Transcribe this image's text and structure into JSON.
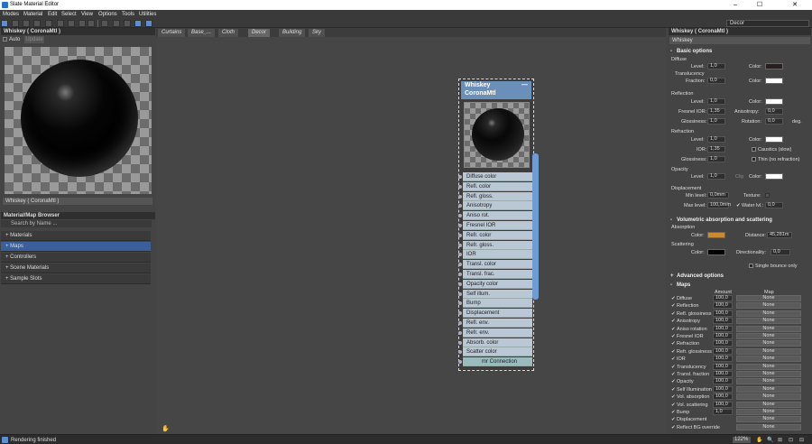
{
  "window": {
    "title": "Slate Material Editor",
    "min": "–",
    "max": "☐",
    "close": "✕",
    "resize": "⤡"
  },
  "menu": [
    "Modes",
    "Material",
    "Edit",
    "Select",
    "View",
    "Options",
    "Tools",
    "Utilities"
  ],
  "view_select": "Decor",
  "left": {
    "material_title": "Whiskey  ( CoronaMtl )",
    "auto_label": "Auto",
    "update_label": "Update",
    "material_dropdown": "Whiskey  ( CoronaMtl )",
    "browser_title": "Material/Map Browser",
    "search_placeholder": "Search by Name ...",
    "browser_items": [
      "+ Materials",
      "+ Maps",
      "+ Controllers",
      "+ Scene Materials",
      "+ Sample Slots"
    ]
  },
  "view_tabs": [
    "Curtains",
    "Base_...",
    "Cloth",
    "Decor",
    "Building",
    "Sky"
  ],
  "node": {
    "title": "Whiskey\nCoronaMtl",
    "collapse": "—",
    "slots": [
      "Diffuse color",
      "Refl. color",
      "Refl. gloss.",
      "Anisotropy",
      "Aniso rot.",
      "Fresnel IOR",
      "Refr. color",
      "Refr. gloss.",
      "IOR",
      "Transl. color",
      "Transl. frac.",
      "Opacity color",
      "Self illum.",
      "Bump",
      "Displacement",
      "Refl. env.",
      "Refr. env.",
      "Absorb. color",
      "Scatter color",
      "mr Connection"
    ]
  },
  "right": {
    "header": "Whiskey  ( CoronaMtl )",
    "name": "Whiskey",
    "basic": "Basic options",
    "diffuse": {
      "title": "Diffuse",
      "level_l": "Level:",
      "level": "1,0",
      "color_l": "Color:"
    },
    "translucency": {
      "title": "Translucency",
      "fraction_l": "Fraction:",
      "fraction": "0,0",
      "color_l": "Color:"
    },
    "reflection": {
      "title": "Reflection",
      "level_l": "Level:",
      "level": "1,0",
      "color_l": "Color:",
      "fresnel_l": "Fresnel IOR:",
      "fresnel": "1,35",
      "aniso_l": "Anisotropy:",
      "aniso": "0,0",
      "gloss_l": "Glossiness:",
      "gloss": "1,0",
      "rot_l": "Rotation:",
      "rot": "0,0",
      "deg": "deg."
    },
    "refraction": {
      "title": "Refraction",
      "level_l": "Level:",
      "level": "1,0",
      "color_l": "Color:",
      "ior_l": "IOR:",
      "ior": "1,35",
      "caustics": "Caustics (slow)",
      "gloss_l": "Glossiness:",
      "gloss": "1,0",
      "thin": "Thin (no refraction)"
    },
    "opacity": {
      "title": "Opacity",
      "level_l": "Level:",
      "level": "1,0",
      "clip": "Clip",
      "color_l": "Color:"
    },
    "displacement": {
      "title": "Displacement",
      "min_l": "Min level:",
      "min": "0,0mm",
      "texture_l": "Texture:",
      "max_l": "Max level:",
      "max": "100,0mm",
      "water_l": "Water lvl.:",
      "water": "0,0"
    },
    "volumetric": "Volumetric absorption and scattering",
    "absorption": {
      "title": "Absorption",
      "color_l": "Color:",
      "dist_l": "Distance:",
      "dist": "45,281m"
    },
    "scattering": {
      "title": "Scattering",
      "color_l": "Color:",
      "dir_l": "Directionality:",
      "dir": "0,0"
    },
    "single_bounce": "Single bounce only",
    "advanced": "Advanced options",
    "maps": "Maps",
    "amount_h": "Amount",
    "map_h": "Map",
    "map_rows": [
      [
        "Diffuse",
        "100,0",
        "None"
      ],
      [
        "Reflection",
        "100,0",
        "None"
      ],
      [
        "Refl. glossiness",
        "100,0",
        "None"
      ],
      [
        "Anisotropy",
        "100,0",
        "None"
      ],
      [
        "Aniso rotation",
        "100,0",
        "None"
      ],
      [
        "Fresnel IOR",
        "100,0",
        "None"
      ],
      [
        "Refraction",
        "100,0",
        "None"
      ],
      [
        "Refr. glossiness",
        "100,0",
        "None"
      ],
      [
        "IOR",
        "100,0",
        "None"
      ],
      [
        "Translucency",
        "100,0",
        "None"
      ],
      [
        "Transl. fraction",
        "100,0",
        "None"
      ],
      [
        "Opacity",
        "100,0",
        "None"
      ],
      [
        "Self Illumination",
        "100,0",
        "None"
      ],
      [
        "Vol. absorption",
        "100,0",
        "None"
      ],
      [
        "Vol. scattering",
        "100,0",
        "None"
      ],
      [
        "Bump",
        "1,0",
        "None"
      ],
      [
        "Displacement",
        "",
        "None"
      ],
      [
        "Reflect BG override",
        "",
        "None"
      ]
    ]
  },
  "status": {
    "text": "Rendering finished",
    "zoom": "122%"
  },
  "colors": {
    "accent": "#5b8fd0",
    "absorption": "#c98a35",
    "diffuse": "#2a1e1e",
    "scatter": "#000000",
    "white": "#ffffff"
  }
}
